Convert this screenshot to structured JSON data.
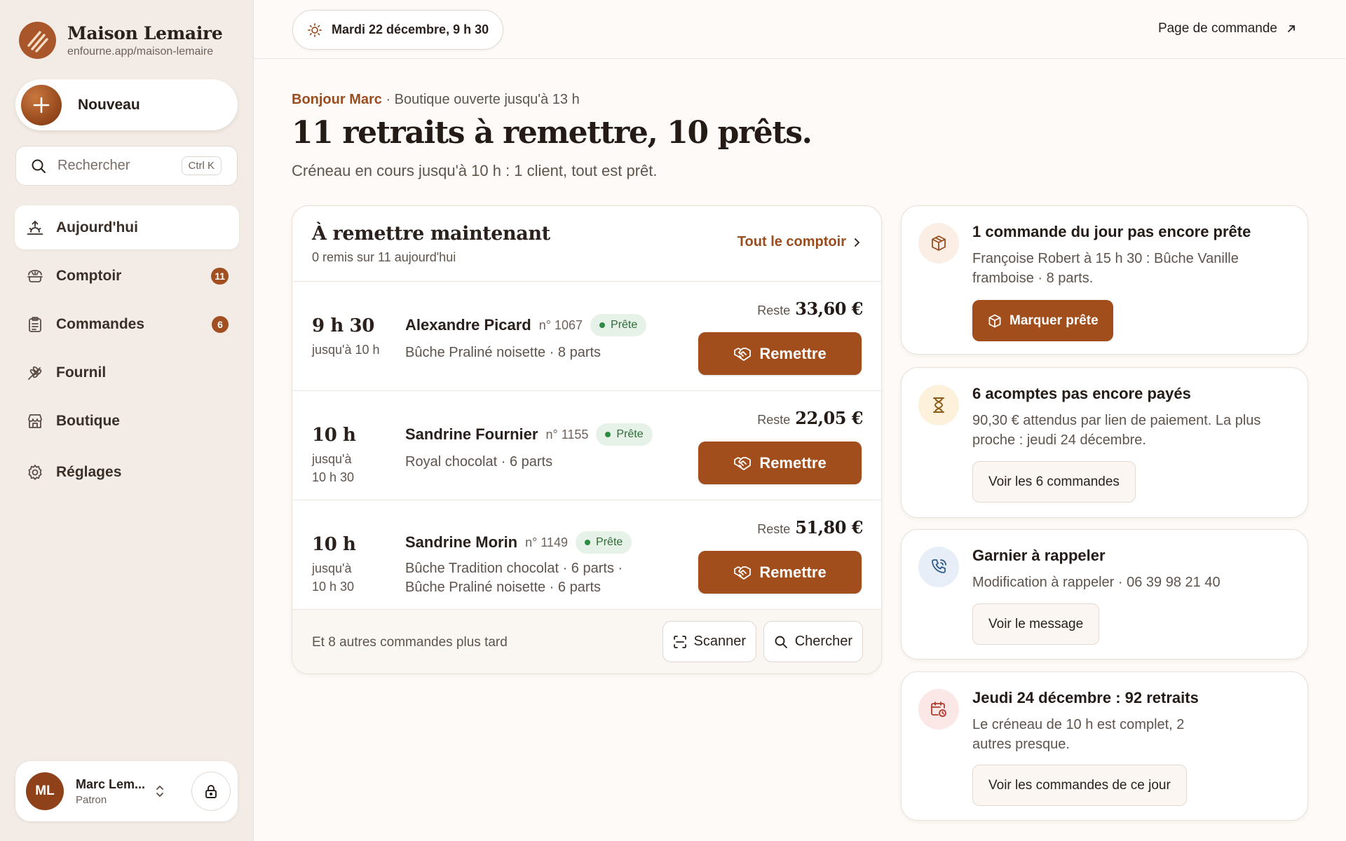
{
  "brand": {
    "name": "Maison Lemaire",
    "url": "enfourne.app/maison-lemaire"
  },
  "new_button": {
    "label": "Nouveau"
  },
  "search": {
    "placeholder": "Rechercher",
    "shortcut": "Ctrl K"
  },
  "nav": {
    "items": [
      {
        "label": "Aujourd'hui",
        "icon": "sunrise-icon",
        "active": true
      },
      {
        "label": "Comptoir",
        "icon": "bread-icon",
        "badge": "11"
      },
      {
        "label": "Commandes",
        "icon": "clipboard-icon",
        "badge": "6"
      },
      {
        "label": "Fournil",
        "icon": "wheat-icon"
      },
      {
        "label": "Boutique",
        "icon": "store-icon"
      },
      {
        "label": "Réglages",
        "icon": "gear-icon"
      }
    ]
  },
  "user": {
    "initials": "ML",
    "name": "Marc Lem...",
    "role": "Patron"
  },
  "topbar": {
    "date": "Mardi 22 décembre, 9 h 30",
    "order_page_link": "Page de commande"
  },
  "hero": {
    "greeting_name": "Bonjour Marc",
    "greeting_rest": " · Boutique ouverte jusqu'à 13 h",
    "headline": "11 retraits à remettre, 10 prêts.",
    "subtitle": "Créneau en cours jusqu'à 10 h : 1 client, tout est prêt."
  },
  "handover": {
    "title": "À remettre maintenant",
    "subtitle": "0 remis sur 11 aujourd'hui",
    "all_link": "Tout le comptoir",
    "rows": [
      {
        "time": "9 h 30",
        "until": "jusqu'à 10 h",
        "customer": "Alexandre Picard",
        "number": "n° 1067",
        "status": "Prête",
        "items": "Bûche Praliné noisette · 8 parts",
        "rest_label": "Reste",
        "rest_amount": "33,60 €",
        "action": "Remettre"
      },
      {
        "time": "10 h",
        "until": "jusqu'à 10 h 30",
        "customer": "Sandrine Fournier",
        "number": "n° 1155",
        "status": "Prête",
        "items": "Royal chocolat · 6 parts",
        "rest_label": "Reste",
        "rest_amount": "22,05 €",
        "action": "Remettre"
      },
      {
        "time": "10 h",
        "until": "jusqu'à 10 h 30",
        "customer": "Sandrine Morin",
        "number": "n° 1149",
        "status": "Prête",
        "items": "Bûche Tradition chocolat · 6 parts · Bûche Praliné noisette · 6 parts",
        "rest_label": "Reste",
        "rest_amount": "51,80 €",
        "action": "Remettre"
      }
    ],
    "footer_text": "Et 8 autres commandes plus tard",
    "scan_label": "Scanner",
    "find_label": "Chercher"
  },
  "alerts": [
    {
      "icon": "box-icon",
      "title": "1 commande du jour pas encore prête",
      "text": "Françoise Robert à 15 h 30 : Bûche Vanille framboise · 8 parts.",
      "button": "Marquer prête",
      "icon_bg": "#fbeee4",
      "icon_color": "#9a4d1f"
    },
    {
      "icon": "hourglass-icon",
      "title": "6 acomptes pas encore payés",
      "text": "90,30 € attendus par lien de paiement. La plus proche : jeudi 24 décembre.",
      "button": "Voir les 6 commandes",
      "icon_bg": "#fdf1dc",
      "icon_color": "#8a5a14"
    },
    {
      "icon": "phone-icon",
      "title": "Garnier à rappeler",
      "text": "Modification à rappeler · 06 39 98 21 40",
      "button": "Voir le message",
      "icon_bg": "#e7eef8",
      "icon_color": "#2e5a8c"
    },
    {
      "icon": "calendar-clock-icon",
      "title": "Jeudi 24 décembre : 92 retraits",
      "text": "Le créneau de 10 h est complet, 2 autres presque.",
      "button": "Voir les commandes de ce jour",
      "icon_bg": "#fbe8e6",
      "icon_color": "#b03a2e"
    }
  ],
  "colors": {
    "accent": "#a14e1c",
    "accent_text": "#9a4d1f",
    "ready_bg": "#e6f2e7",
    "ready_text": "#2d6a37",
    "sidebar_bg": "#f3ece6",
    "page_bg": "#fdfaf7"
  }
}
